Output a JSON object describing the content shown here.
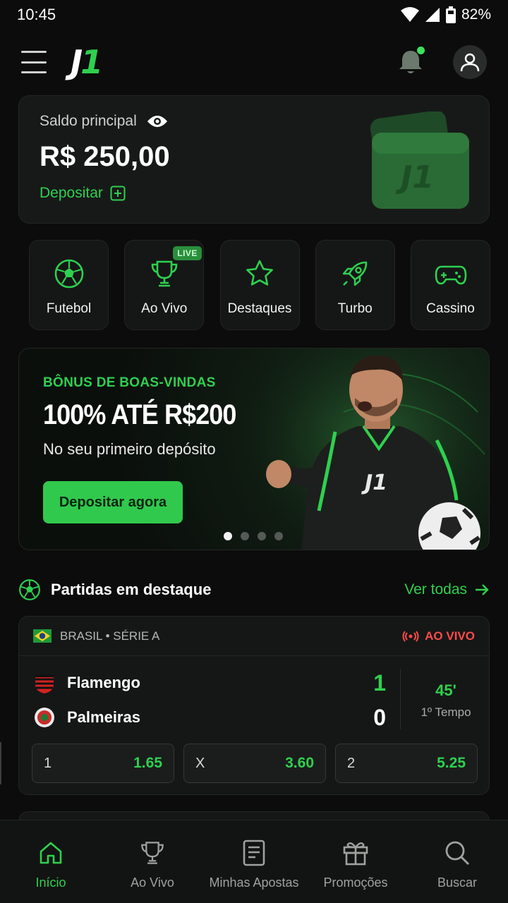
{
  "status_bar": {
    "time": "10:45",
    "battery": "82%"
  },
  "header": {
    "logo_text": "J",
    "logo_accent": "1"
  },
  "balance": {
    "label": "Saldo principal",
    "amount": "R$ 250,00",
    "deposit_label": "Depositar",
    "wallet_logo": "J1"
  },
  "categories": [
    {
      "label": "Futebol",
      "icon": "soccer-ball-icon"
    },
    {
      "label": "Ao Vivo",
      "icon": "trophy-icon",
      "badge": "LIVE"
    },
    {
      "label": "Destaques",
      "icon": "star-icon"
    },
    {
      "label": "Turbo",
      "icon": "rocket-icon"
    },
    {
      "label": "Cassino",
      "icon": "gamepad-icon"
    }
  ],
  "promo": {
    "kicker": "BÔNUS DE BOAS-VINDAS",
    "title": "100% ATÉ R$200",
    "subtitle": "No seu primeiro depósito",
    "button": "Depositar agora",
    "shirt_logo": "J1",
    "slides": 4,
    "active_slide": 1
  },
  "featured": {
    "title": "Partidas em destaque",
    "see_all": "Ver todas",
    "match": {
      "league": "BRASIL • SÉRIE A",
      "live_label": "AO VIVO",
      "home_team": "Flamengo",
      "away_team": "Palmeiras",
      "home_score": "1",
      "away_score": "0",
      "minute": "45'",
      "period": "1º Tempo",
      "odds": [
        {
          "label": "1",
          "value": "1.65"
        },
        {
          "label": "X",
          "value": "3.60"
        },
        {
          "label": "2",
          "value": "5.25"
        }
      ]
    }
  },
  "bottom_nav": [
    {
      "label": "Início",
      "icon": "home-icon",
      "active": true
    },
    {
      "label": "Ao Vivo",
      "icon": "trophy-icon",
      "active": false
    },
    {
      "label": "Minhas Apostas",
      "icon": "document-icon",
      "active": false
    },
    {
      "label": "Promoções",
      "icon": "gift-icon",
      "active": false
    },
    {
      "label": "Buscar",
      "icon": "search-icon",
      "active": false
    }
  ],
  "colors": {
    "accent": "#2fd04f",
    "live": "#ff4a4a",
    "background": "#0b0c0b",
    "card": "#151716"
  }
}
